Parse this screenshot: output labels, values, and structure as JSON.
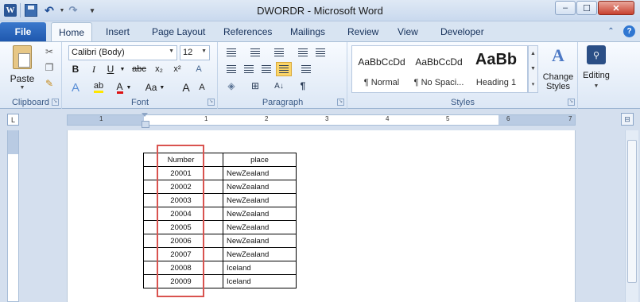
{
  "window": {
    "title": "DWORDR - Microsoft Word",
    "app_icon_letter": "W"
  },
  "tabs": {
    "file": "File",
    "home": "Home",
    "insert": "Insert",
    "page_layout": "Page Layout",
    "references": "References",
    "mailings": "Mailings",
    "review": "Review",
    "view": "View",
    "developer": "Developer"
  },
  "ribbon": {
    "clipboard": {
      "label": "Clipboard",
      "paste_label": "Paste"
    },
    "font": {
      "label": "Font",
      "font_name": "Calibri (Body)",
      "font_size": "12",
      "bold": "B",
      "italic": "I",
      "underline": "U",
      "strikethrough": "abc",
      "subscript": "x₂",
      "superscript": "x²",
      "grow": "A",
      "shrink": "A",
      "change_case": "Aa",
      "clear_format": "A",
      "font_color": "A",
      "text_effect": "A"
    },
    "paragraph": {
      "label": "Paragraph",
      "show_marks": "¶"
    },
    "styles": {
      "label": "Styles",
      "items": [
        {
          "preview": "AaBbCcDd",
          "name": "¶ Normal"
        },
        {
          "preview": "AaBbCcDd",
          "name": "¶ No Spaci..."
        },
        {
          "preview": "AaBb",
          "name": "Heading 1"
        }
      ],
      "change_styles_label": "Change Styles"
    },
    "editing": {
      "label": "Editing"
    }
  },
  "ruler": {
    "numbers": [
      "1",
      "1",
      "2",
      "3",
      "4",
      "5",
      "6",
      "7"
    ]
  },
  "document": {
    "table": {
      "headers": [
        "",
        "Number",
        "",
        "place"
      ],
      "rows": [
        [
          "",
          "20001",
          "",
          "NewZealand"
        ],
        [
          "",
          "20002",
          "",
          "NewZealand"
        ],
        [
          "",
          "20003",
          "",
          "NewZealand"
        ],
        [
          "",
          "20004",
          "",
          "NewZealand"
        ],
        [
          "",
          "20005",
          "",
          "NewZealand"
        ],
        [
          "",
          "20006",
          "",
          "NewZealand"
        ],
        [
          "",
          "20007",
          "",
          "NewZealand"
        ],
        [
          "",
          "20008",
          "",
          "Iceland"
        ],
        [
          "",
          "20009",
          "",
          "Iceland"
        ]
      ]
    }
  },
  "colors": {
    "file_tab": "#2a66bd",
    "highlight_box": "#d9534f",
    "ribbon_bg": "#dce7f5"
  }
}
